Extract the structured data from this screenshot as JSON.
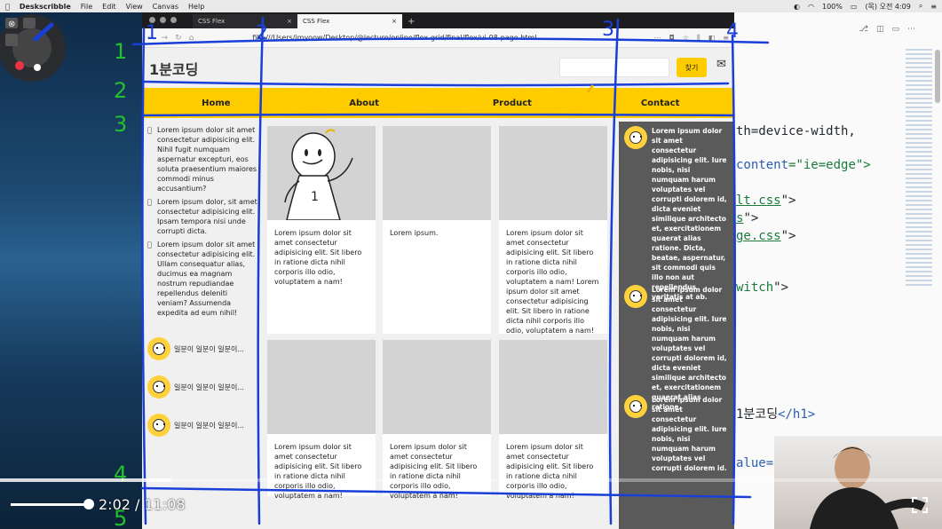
{
  "menubar": {
    "app_name": "Deskscribble",
    "menus": [
      "File",
      "Edit",
      "View",
      "Canvas",
      "Help"
    ],
    "battery": "100%",
    "clock": "(목) 오전 4:09"
  },
  "browser": {
    "tabs": [
      {
        "label": "CSS Flex",
        "active": false
      },
      {
        "label": "CSS Flex",
        "active": true
      }
    ],
    "url": "file:///Users/jmyoow/Desktop/@lecture/online/flex-grid/final/flex/ui-08-page.html",
    "new_tab": "+",
    "close": "×"
  },
  "page": {
    "logo": "1분코딩",
    "search_placeholder": "",
    "search_button": "찾기",
    "nav": [
      "Home",
      "About",
      "Product",
      "Contact"
    ],
    "left_texts": [
      "Lorem ipsum dolor sit amet consectetur adipisicing elit. Nihil fugit numquam aspernatur excepturi, eos soluta praesentium maiores commodi minus accusantium?",
      "Lorem ipsum dolor, sit amet consectetur adipisicing elit. Ipsam tempora nisi unde corrupti dicta.",
      "Lorem ipsum dolor sit amet consectetur adipisicing elit. Ullam consequatur alias, ducimus ea magnam nostrum repudiandae repellendus deleniti veniam? Assumenda expedita ad eum nihil!"
    ],
    "left_profiles": [
      "일분이 일분이 일분이...",
      "일분이 일분이 일분이...",
      "일분이 일분이 일분이..."
    ],
    "cards": [
      "Lorem ipsum dolor sit amet consectetur adipisicing elit. Sit libero in ratione dicta nihil corporis illo odio, voluptatem a nam!",
      "Lorem ipsum.",
      "Lorem ipsum dolor sit amet consectetur adipisicing elit. Sit libero in ratione dicta nihil corporis illo odio, voluptatem a nam! Lorem ipsum dolor sit amet consectetur adipisicing elit. Sit libero in ratione dicta nihil corporis illo odio, voluptatem a nam!",
      "Lorem ipsum dolor sit amet consectetur adipisicing elit. Sit libero in ratione dicta nihil corporis illo odio, voluptatem a nam!",
      "Lorem ipsum dolor sit amet consectetur adipisicing elit. Sit libero in ratione dicta nihil corporis illo odio, voluptatem a nam!",
      "Lorem ipsum dolor sit amet consectetur adipisicing elit. Sit libero in ratione dicta nihil corporis illo odio, voluptatem a nam!"
    ],
    "card_figure_label": "1",
    "right_texts": [
      "Lorem ipsum dolor sit amet consectetur adipisicing elit. Iure nobis, nisi numquam harum voluptates vel corrupti dolorem id, dicta eveniet similique architecto et, exercitationem quaerat alias ratione. Dicta, beatae, aspernatur, sit commodi quis illo non aut repellendus veritatis at ab.",
      "Lorem ipsum dolor sit amet consectetur adipisicing elit. Iure nobis, nisi numquam harum voluptates vel corrupti dolorem id, dicta eveniet similique architecto et, exercitationem quaerat alias ratione.",
      "Lorem ipsum dolor sit amet consectetur adipisicing elit. Iure nobis, nisi numquam harum voluptates vel corrupti dolorem id."
    ]
  },
  "editor": {
    "lines": [
      {
        "pre": "th=device-width,",
        "kw": "",
        "post": ""
      },
      {
        "pre": " ",
        "kw": "content",
        "post": "=\"ie=edge\">"
      },
      {
        "pre": "",
        "kw": "lt.css",
        "post": "\">"
      },
      {
        "pre": "",
        "kw": "s",
        "post": "\">"
      },
      {
        "pre": "",
        "kw": "ge.css",
        "post": "\">"
      },
      {
        "pre": "",
        "kw": "witch",
        "post": "\">"
      },
      {
        "pre": "1분코딩",
        "kw": "</h1>",
        "post": ""
      },
      {
        "pre": "alue=\"",
        "kw": "",
        "post": ""
      }
    ]
  },
  "annotations": {
    "column_numbers": [
      "1",
      "2",
      "3",
      "4"
    ],
    "row_numbers": [
      "1",
      "2",
      "3",
      "4",
      "5"
    ],
    "colors": {
      "column": "#1a3fd8",
      "row": "#22c22e"
    }
  },
  "video": {
    "time": "2:02 / 11:08",
    "progress": 0.182
  },
  "colors": {
    "accent": "#ffcc00",
    "sidebar_dark": "#5a5a5a"
  }
}
